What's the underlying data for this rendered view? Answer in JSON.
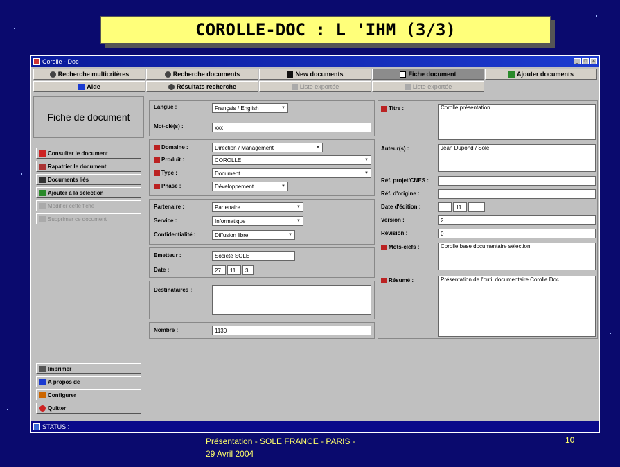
{
  "slide": {
    "title": "COROLLE-DOC : L 'IHM (3/3)",
    "footer_line1": "Présentation - SOLE FRANCE - PARIS -",
    "footer_line2": "29 Avril 2004",
    "page_number": "10"
  },
  "window": {
    "title": "Corolle - Doc"
  },
  "tabs_row1": [
    {
      "label": "Recherche multicritères",
      "icon": "search-icon"
    },
    {
      "label": "Recherche documents",
      "icon": "search-icon"
    },
    {
      "label": "New documents",
      "icon": "save-icon"
    },
    {
      "label": "Fiche document",
      "icon": "document-icon"
    },
    {
      "label": "Ajouter documents",
      "icon": "plus-icon"
    }
  ],
  "tabs_row2": [
    {
      "label": "Aide",
      "icon": "help-icon"
    },
    {
      "label": "Résultats recherche",
      "icon": "search-icon"
    },
    {
      "label": "Liste exportée",
      "icon": "list-icon"
    },
    {
      "label": "Liste exportée",
      "icon": "list-icon"
    }
  ],
  "left_panel": {
    "title": "Fiche de document",
    "actions": [
      {
        "label": "Consulter le document",
        "icon": "pdf-icon",
        "enabled": true
      },
      {
        "label": "Rapatrier le document",
        "icon": "download-icon",
        "enabled": true
      },
      {
        "label": "Documents liés",
        "icon": "link-icon",
        "enabled": true
      },
      {
        "label": "Ajouter à la sélection",
        "icon": "add-icon",
        "enabled": true
      },
      {
        "label": "Modifier cette fiche",
        "icon": "edit-icon",
        "enabled": false
      },
      {
        "label": "Supprimer ce document",
        "icon": "delete-icon",
        "enabled": false
      }
    ],
    "bottom_actions": [
      {
        "label": "Imprimer",
        "icon": "printer-icon"
      },
      {
        "label": "A propos de",
        "icon": "info-icon"
      },
      {
        "label": "Configurer",
        "icon": "config-icon"
      },
      {
        "label": "Quitter",
        "icon": "quit-icon"
      }
    ]
  },
  "form_left": {
    "langue_label": "Langue :",
    "langue_value": "Français / English",
    "mots_cles_label": "Mot-clé(s) :",
    "mots_cles_value": "xxx",
    "domaine_label": "Domaine :",
    "domaine_value": "Direction / Management",
    "produit_label": "Produit :",
    "produit_value": "COROLLE",
    "type_label": "Type :",
    "type_value": "Document",
    "phase_label": "Phase :",
    "phase_value": "Développement",
    "partenaire_label": "Partenaire :",
    "partenaire_value": "Partenaire",
    "service_label": "Service :",
    "service_value": "Informatique",
    "confidentialite_label": "Confidentialité :",
    "confidentialite_value": "Diffusion libre",
    "emetteur_label": "Emetteur :",
    "emetteur_value": "Société SOLE",
    "date_label": "Date :",
    "date_d": "27",
    "date_m": "11",
    "date_y": "3",
    "destinataires_label": "Destinataires :",
    "destinataires_value": "",
    "nombre_label": "Nombre :",
    "nombre_value": "1130"
  },
  "form_right": {
    "titre_label": "Titre :",
    "titre_value": "Corolle présentation",
    "auteurs_label": "Auteur(s) :",
    "auteurs_value": "Jean Dupond / Sole",
    "ref_label": "Réf. projet/CNES :",
    "ref_value": "",
    "ref_origine_label": "Réf. d'origine :",
    "ref_origine_value": "",
    "date_edition_label": "Date d'édition :",
    "date_edition_d": "",
    "date_edition_m": "11",
    "date_edition_y": "",
    "version_label": "Version :",
    "version_value": "2",
    "revision_label": "Révision :",
    "revision_value": "0",
    "mots_cles_label": "Mots-clefs :",
    "mots_cles_value": "Corolle base documentaire sélection",
    "resume_label": "Résumé :",
    "resume_value": "Présentation de l'outil documentaire Corolle Doc"
  },
  "status": {
    "label": "STATUS :"
  },
  "colors": {
    "slide_bg": "#0a0a6e",
    "title_bg": "#ffff7a",
    "window_bg": "#c0c0c0",
    "footer_text": "#ffff6a"
  }
}
